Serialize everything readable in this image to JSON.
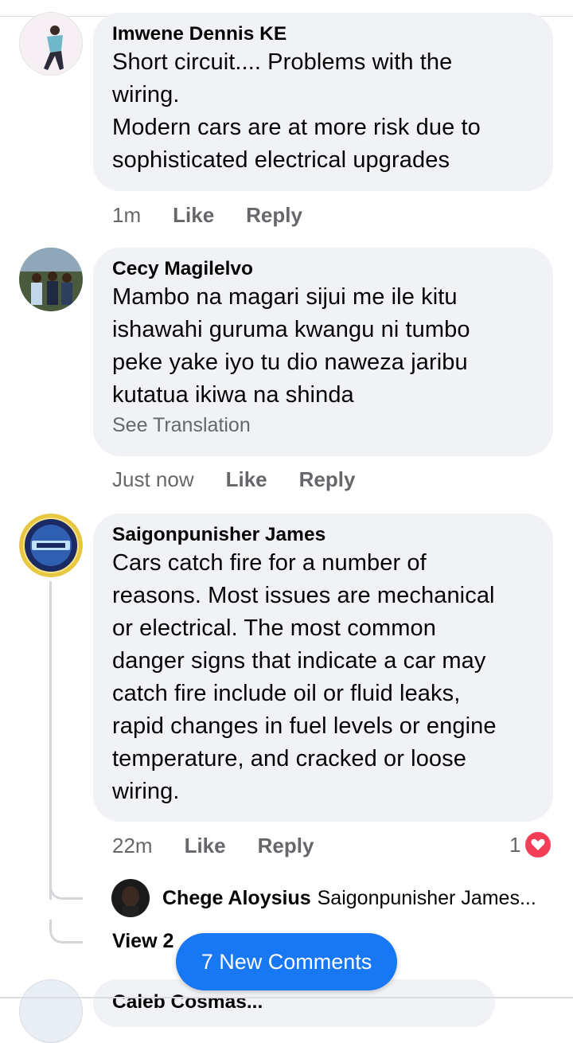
{
  "comments": [
    {
      "author": "Imwene Dennis KE",
      "lines": [
        "Short circuit.... Problems with the",
        "wiring.",
        "Modern cars are at more risk due to",
        "sophisticated electrical upgrades"
      ],
      "time": "1m",
      "like_label": "Like",
      "reply_label": "Reply"
    },
    {
      "author": "Cecy Magilelvo",
      "lines": [
        "Mambo na magari sijui me ile kitu",
        "ishawahi guruma kwangu ni tumbo",
        "peke yake iyo tu dio naweza jaribu",
        "kutatua ikiwa na shinda"
      ],
      "see_translation": "See Translation",
      "time": "Just now",
      "like_label": "Like",
      "reply_label": "Reply"
    },
    {
      "author": "Saigonpunisher James",
      "lines": [
        "Cars catch fire for a number of",
        "reasons. Most issues are mechanical",
        "or electrical. The most common",
        "danger signs that indicate a car may",
        "catch fire include oil or fluid leaks,",
        "rapid changes in fuel levels or engine",
        "temperature, and cracked or loose",
        "wiring."
      ],
      "time": "22m",
      "like_label": "Like",
      "reply_label": "Reply",
      "reaction_count": "1",
      "reaction_icon": "heart-icon",
      "reaction_color": "#f33e58"
    }
  ],
  "reply_preview": {
    "author": "Chege Aloysius",
    "text": "Saigonpunisher James..."
  },
  "view_more": "View 2",
  "new_comments_button": "7 New Comments",
  "next_comment_author": "Caleb Cosmas..."
}
